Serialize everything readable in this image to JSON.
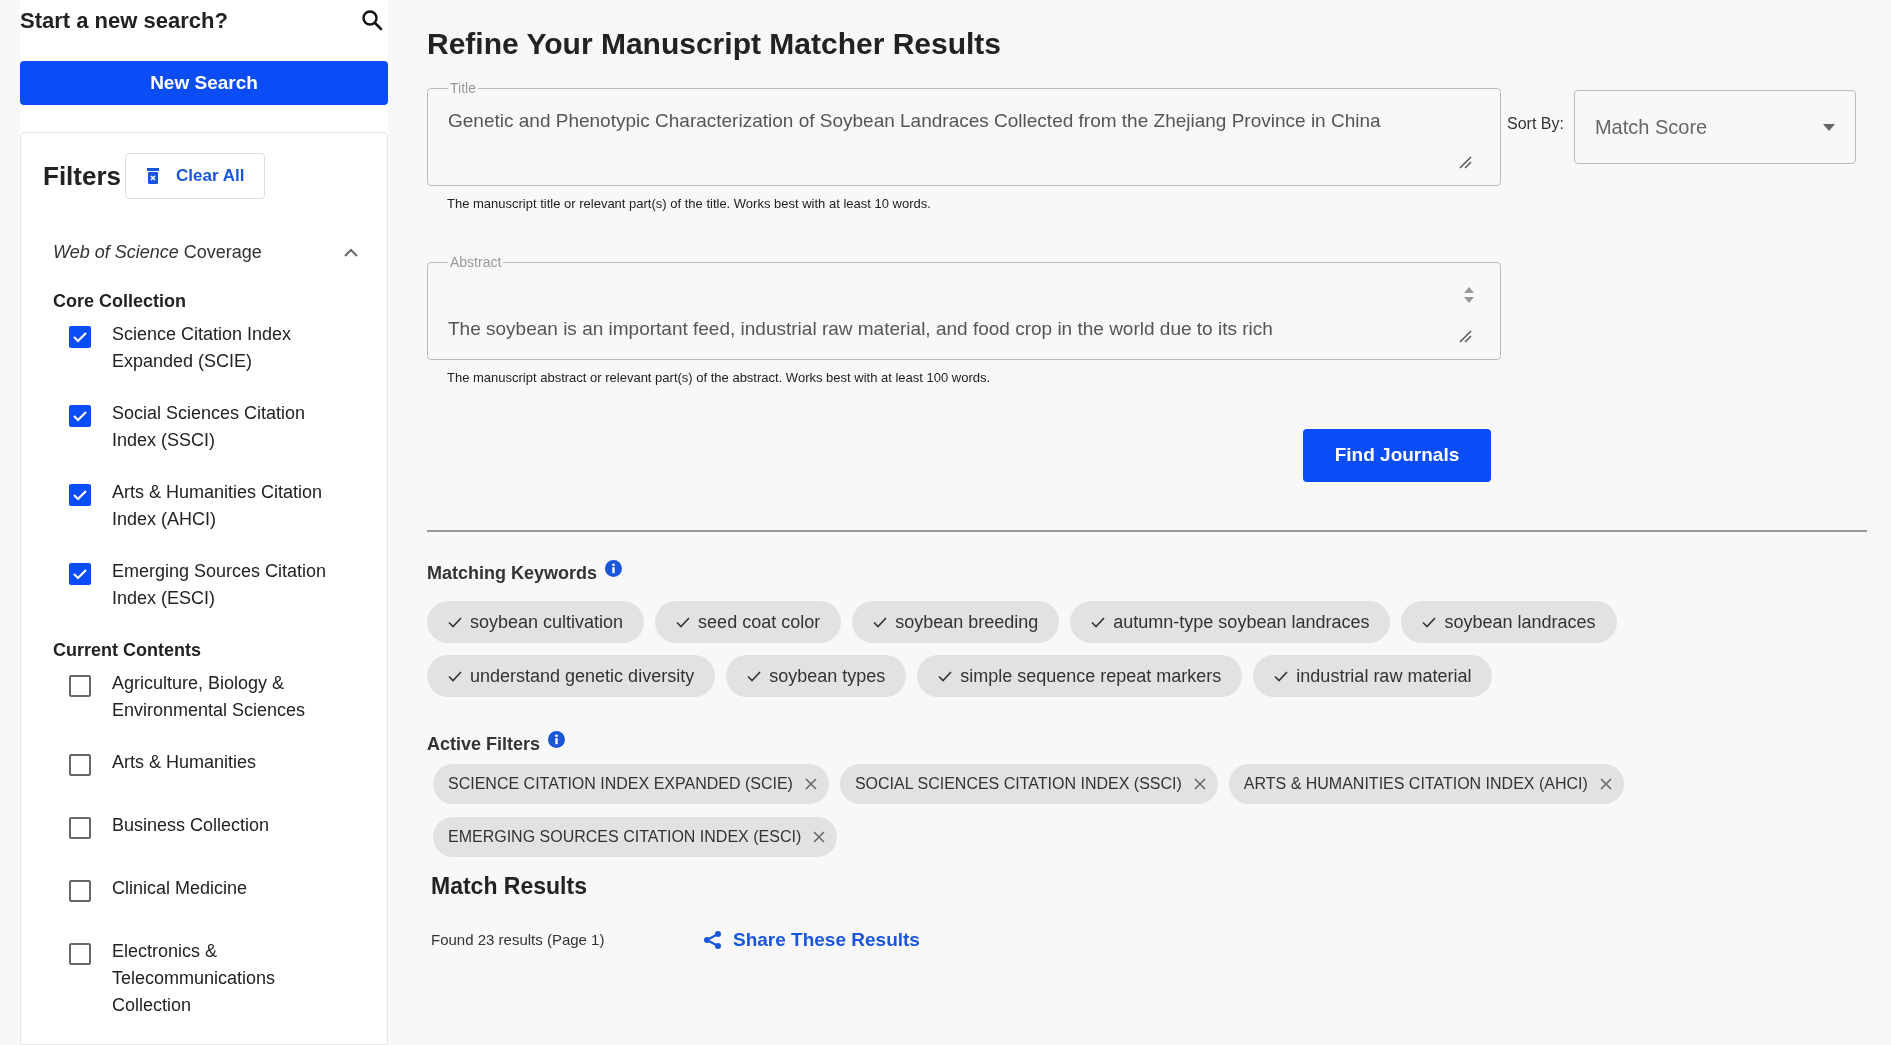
{
  "sidebar": {
    "heading": "Start a new search?",
    "new_search_button": "New Search",
    "filters": {
      "title": "Filters",
      "clear_button": "Clear All",
      "group": {
        "title": "*Web of Science* Coverage",
        "expanded": true,
        "sections": [
          {
            "title": "Core Collection",
            "items": [
              {
                "label": "Science Citation Index Expanded (SCIE)",
                "checked": true
              },
              {
                "label": "Social Sciences Citation Index (SSCI)",
                "checked": true
              },
              {
                "label": "Arts & Humanities Citation Index (AHCI)",
                "checked": true
              },
              {
                "label": "Emerging Sources Citation Index (ESCI)",
                "checked": true
              }
            ]
          },
          {
            "title": "Current Contents",
            "items": [
              {
                "label": "Agriculture, Biology & Environmental Sciences",
                "checked": false
              },
              {
                "label": "Arts & Humanities",
                "checked": false
              },
              {
                "label": "Business Collection",
                "checked": false
              },
              {
                "label": "Clinical Medicine",
                "checked": false
              },
              {
                "label": "Electronics & Telecommunications Collection",
                "checked": false
              }
            ]
          }
        ]
      }
    }
  },
  "main": {
    "heading": "Refine Your Manuscript Matcher Results",
    "title_field": {
      "label": "Title",
      "value": "Genetic and Phenotypic Characterization of Soybean Landraces Collected from the Zhejiang Province in China",
      "help": "The manuscript title or relevant part(s) of the title. Works best with at least 10 words."
    },
    "sort": {
      "label": "Sort By:",
      "value": "Match Score"
    },
    "abstract_field": {
      "label": "Abstract",
      "value": "The soybean is an important feed, industrial raw material, and food crop in the world due to its rich",
      "help": "The manuscript abstract or relevant part(s) of the abstract. Works best with at least 100 words."
    },
    "find_button": "Find Journals",
    "keywords": {
      "title": "Matching Keywords",
      "items": [
        "soybean cultivation",
        "seed coat color",
        "soybean breeding",
        "autumn-type soybean landraces",
        "soybean landraces",
        "understand genetic diversity",
        "soybean types",
        "simple sequence repeat markers",
        "industrial raw material"
      ]
    },
    "active_filters": {
      "title": "Active Filters",
      "items": [
        "SCIENCE CITATION INDEX EXPANDED (SCIE)",
        "SOCIAL SCIENCES CITATION INDEX (SSCI)",
        "ARTS & HUMANITIES CITATION INDEX (AHCI)",
        "EMERGING SOURCES CITATION INDEX (ESCI)"
      ]
    },
    "results": {
      "title": "Match Results",
      "count": "Found 23 results (Page 1)",
      "share": "Share These Results"
    }
  }
}
